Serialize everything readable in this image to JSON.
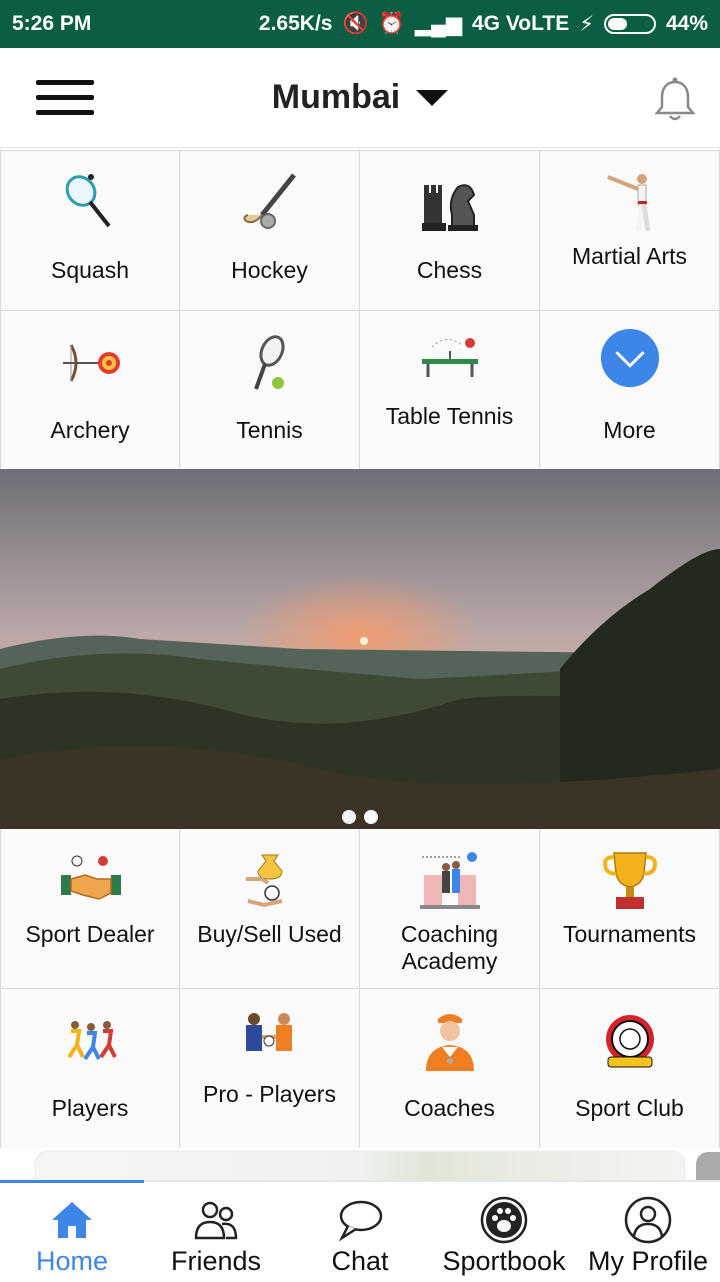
{
  "status_bar": {
    "time": "5:26 PM",
    "speed": "2.65K/s",
    "network": "4G VoLTE",
    "battery": "44%",
    "battery_level": 0.44
  },
  "header": {
    "city": "Mumbai",
    "menu_icon": "hamburger-icon",
    "notification_icon": "bell-icon"
  },
  "sports": [
    {
      "label": "Squash",
      "icon": "squash-racket-icon"
    },
    {
      "label": "Hockey",
      "icon": "hockey-stick-icon"
    },
    {
      "label": "Chess",
      "icon": "chess-pieces-icon"
    },
    {
      "label": "Martial Arts",
      "icon": "martial-arts-icon"
    },
    {
      "label": "Archery",
      "icon": "archery-icon"
    },
    {
      "label": "Tennis",
      "icon": "tennis-racket-icon"
    },
    {
      "label": "Table Tennis",
      "icon": "table-tennis-icon"
    },
    {
      "label": "More",
      "icon": "chevron-down-icon"
    }
  ],
  "banner": {
    "slides": 2,
    "active_slide": 1
  },
  "services": [
    {
      "label": "Sport Dealer",
      "icon": "handshake-icon"
    },
    {
      "label": "Buy/Sell Used",
      "icon": "money-exchange-icon"
    },
    {
      "label": "Coaching Academy",
      "icon": "coaching-academy-icon"
    },
    {
      "label": "Tournaments",
      "icon": "trophy-icon"
    },
    {
      "label": "Players",
      "icon": "runners-icon"
    },
    {
      "label": "Pro - Players",
      "icon": "pro-players-icon"
    },
    {
      "label": "Coaches",
      "icon": "coach-icon"
    },
    {
      "label": "Sport Club",
      "icon": "club-crest-icon"
    }
  ],
  "bottom_nav": [
    {
      "label": "Home",
      "icon": "home-icon",
      "active": true
    },
    {
      "label": "Friends",
      "icon": "friends-icon",
      "active": false
    },
    {
      "label": "Chat",
      "icon": "chat-bubble-icon",
      "active": false
    },
    {
      "label": "Sportbook",
      "icon": "paw-icon",
      "active": false
    },
    {
      "label": "My Profile",
      "icon": "profile-icon",
      "active": false
    }
  ],
  "colors": {
    "status_bar": "#0b5e43",
    "accent": "#3d86e8"
  }
}
